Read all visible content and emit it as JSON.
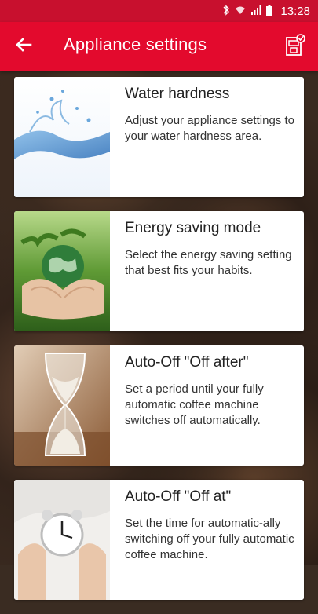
{
  "statusbar": {
    "time": "13:28",
    "icons": [
      "bluetooth-icon",
      "wifi-icon",
      "signal-icon",
      "battery-icon"
    ]
  },
  "appbar": {
    "title": "Appliance settings",
    "back_icon": "arrow-left-icon",
    "action_icon": "appliance-settings-icon",
    "color": "#e30a2d"
  },
  "cards": [
    {
      "title": "Water hardness",
      "description": "Adjust your appliance settings to your water hardness area.",
      "image": "water-splash-image"
    },
    {
      "title": "Energy saving mode",
      "description": "Select the energy saving setting that best fits your habits.",
      "image": "hands-holding-globe-image"
    },
    {
      "title": "Auto-Off \"Off after\"",
      "description": "Set a period until your fully automatic coffee machine switches off automatically.",
      "image": "hourglass-image"
    },
    {
      "title": "Auto-Off \"Off at\"",
      "description": "Set the time for automatic-ally switching off your fully automatic coffee machine.",
      "image": "alarm-clock-image"
    }
  ]
}
